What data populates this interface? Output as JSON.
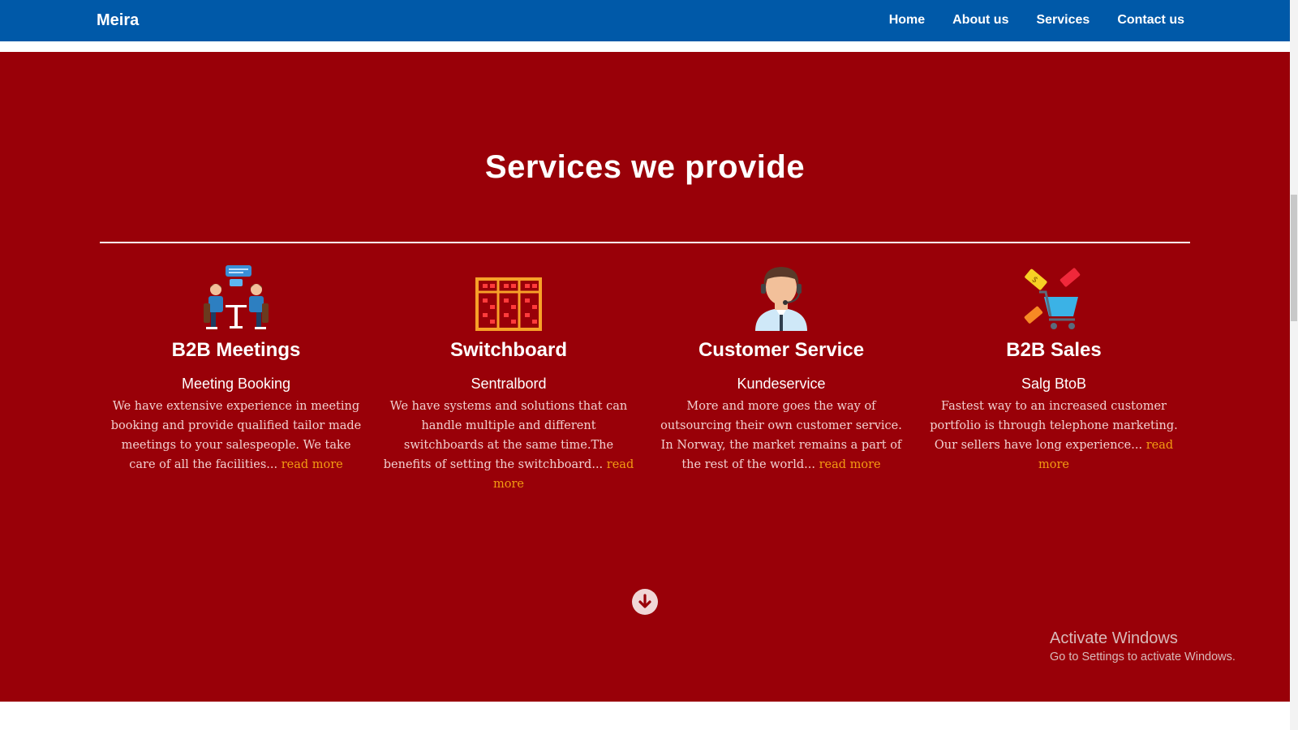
{
  "navbar": {
    "brand": "Meira",
    "links": [
      "Home",
      "About us",
      "Services",
      "Contact us"
    ]
  },
  "services": {
    "title": "Services we provide",
    "cards": [
      {
        "icon": "meeting-icon",
        "title": "B2B Meetings",
        "subtitle": "Meeting Booking",
        "text": "We have extensive experience in meeting booking and provide qualified tailor made meetings to your salespeople. We take care of all the facilities...",
        "link": "read more"
      },
      {
        "icon": "switchboard-icon",
        "title": "Switchboard",
        "subtitle": "Sentralbord",
        "text": "We have systems and solutions that can handle multiple and different switchboards at the same time.The benefits of setting the switchboard...",
        "link": "read more"
      },
      {
        "icon": "customer-service-icon",
        "title": "Customer Service",
        "subtitle": "Kundeservice",
        "text": "More and more goes the way of outsourcing their own customer service. In Norway, the market remains a part of the rest of the world...",
        "link": "read more"
      },
      {
        "icon": "shopping-cart-icon",
        "title": "B2B Sales",
        "subtitle": "Salg BtoB",
        "text": "Fastest way to an increased customer portfolio is through telephone marketing. Our sellers have long experience...",
        "link": "read more"
      }
    ],
    "scroll_icon": "arrow-down-circle-icon"
  },
  "watermark": {
    "title": "Activate Windows",
    "subtitle": "Go to Settings to activate Windows."
  },
  "colors": {
    "navbar": "#0059a8",
    "section": "#990008",
    "link": "#f39c12"
  }
}
